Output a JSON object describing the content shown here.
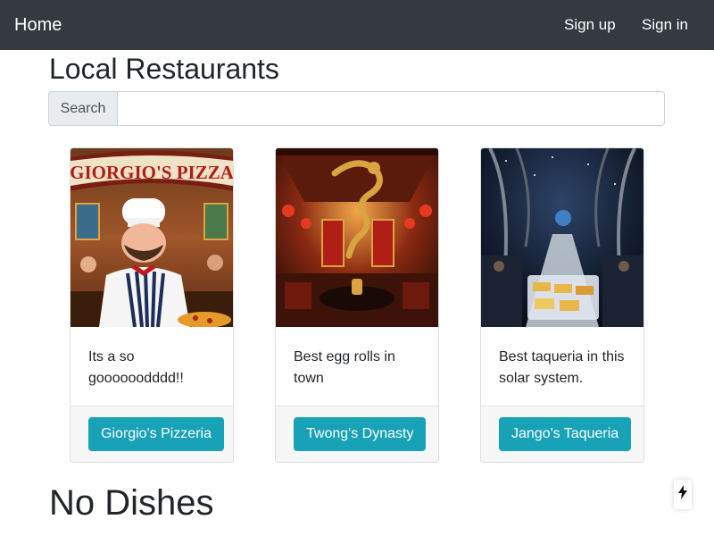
{
  "navbar": {
    "brand": "Home",
    "links": [
      {
        "label": "Sign up"
      },
      {
        "label": "Sign in"
      }
    ]
  },
  "page": {
    "title": "Local Restaurants"
  },
  "search": {
    "label": "Search",
    "value": "",
    "placeholder": ""
  },
  "restaurants": [
    {
      "image_label": "GIORGIO'S PIZZA",
      "description": "Its a so goooooodddd!!",
      "button_label": "Giorgio's Pizzeria",
      "image_subject": "cartoon chef in a pizzeria"
    },
    {
      "image_label": "",
      "description": "Best egg rolls in town",
      "button_label": "Twong's Dynasty",
      "image_subject": "red chinese dining hall with dragon"
    },
    {
      "image_label": "",
      "description": "Best taqueria in this solar system.",
      "button_label": "Jango's Taqueria",
      "image_subject": "space station taqueria"
    }
  ],
  "dishes": {
    "heading": "No Dishes"
  },
  "colors": {
    "navbar": "#343a40",
    "button": "#17a2b8"
  },
  "icons": {
    "badge": "bolt-icon"
  }
}
